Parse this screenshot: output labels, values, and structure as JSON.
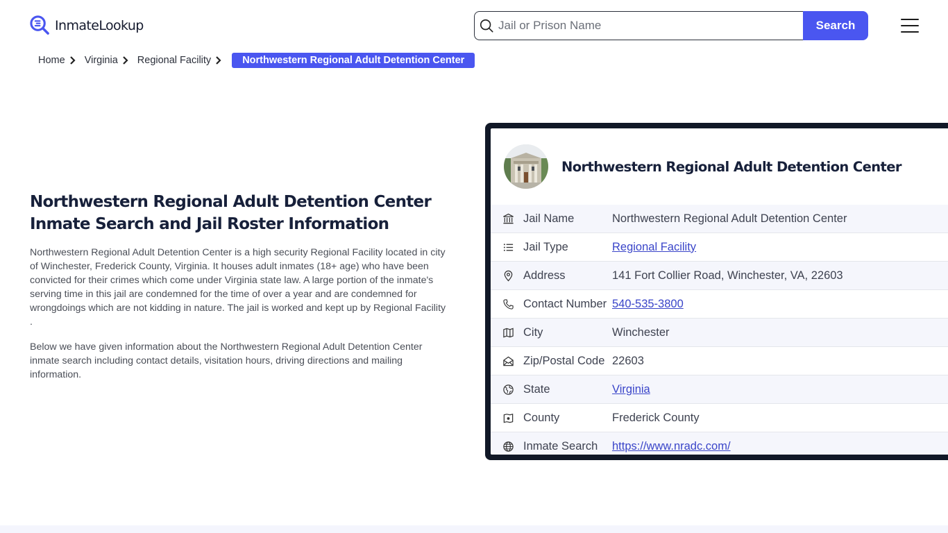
{
  "header": {
    "logo_text": "InmateLookup",
    "search_placeholder": "Jail or Prison Name",
    "search_value": "",
    "search_button": "Search",
    "brand_color": "#4a56f0"
  },
  "breadcrumb": {
    "items": [
      "Home",
      "Virginia",
      "Regional Facility"
    ],
    "active": "Northwestern Regional Adult Detention Center"
  },
  "main": {
    "title": "Northwestern Regional Adult Detention Center Inmate Search and Jail Roster Information",
    "paragraphs": [
      "Northwestern Regional Adult Detention Center is a high security Regional Facility located in city of Winchester, Frederick County, Virginia. It houses adult inmates (18+ age) who have been convicted for their crimes which come under Virginia state law. A large portion of the inmate's serving time in this jail are condemned for the time of over a year and are condemned for wrongdoings which are not kidding in nature. The jail is worked and kept up by Regional Facility .",
      "Below we have given information about the Northwestern Regional Adult Detention Center inmate search including contact details, visitation hours, driving directions and mailing information."
    ]
  },
  "card": {
    "title": "Northwestern Regional Adult Detention Center",
    "rows": [
      {
        "icon": "bank-icon",
        "label": "Jail Name",
        "value": "Northwestern Regional Adult Detention Center",
        "link": false
      },
      {
        "icon": "list-icon",
        "label": "Jail Type",
        "value": "Regional Facility",
        "link": true
      },
      {
        "icon": "map-pin-icon",
        "label": "Address",
        "value": "141 Fort Collier Road, Winchester, VA, 22603",
        "link": false
      },
      {
        "icon": "phone-icon",
        "label": "Contact Number",
        "value": "540-535-3800",
        "link": true
      },
      {
        "icon": "map-icon",
        "label": "City",
        "value": "Winchester",
        "link": false
      },
      {
        "icon": "mail-open-icon",
        "label": "Zip/Postal Code",
        "value": "22603",
        "link": false
      },
      {
        "icon": "globe-alt-icon",
        "label": "State",
        "value": "Virginia",
        "link": true
      },
      {
        "icon": "map-marker-icon",
        "label": "County",
        "value": "Frederick County",
        "link": false
      },
      {
        "icon": "globe-icon",
        "label": "Inmate Search",
        "value": "https://www.nradc.com/",
        "link": true
      }
    ]
  }
}
